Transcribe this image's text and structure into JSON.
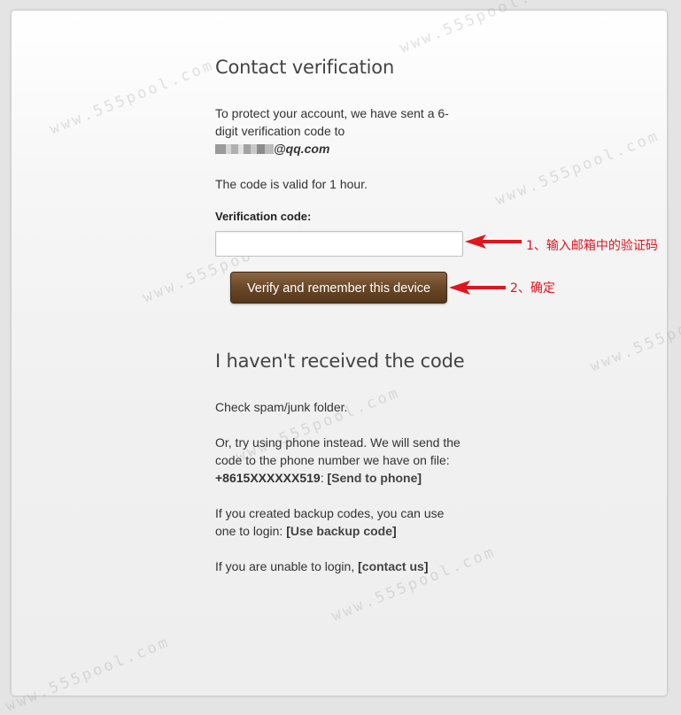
{
  "page": {
    "title": "Contact verification",
    "intro_text": "To protect your account, we have sent a 6-digit verification code to",
    "email_masked_suffix": "@qq.com",
    "validity_text": "The code is valid for 1 hour.",
    "code_label": "Verification code:",
    "code_value": "",
    "verify_button_label": "Verify and remember this device"
  },
  "not_received": {
    "title": "I haven't received the code",
    "spam_text": "Check spam/junk folder.",
    "phone_text": "Or, try using phone instead. We will send the code to the phone number we have on file:",
    "phone_number": "+8615XXXXXX519",
    "phone_sep": ": ",
    "send_to_phone_link": "Send to phone",
    "backup_text": "If you created backup codes, you can use one to login:",
    "use_backup_link": "Use backup code",
    "unable_text": "If you are unable to login,",
    "contact_us_link": "contact us"
  },
  "annotations": {
    "step1": "1、输入邮箱中的验证码",
    "step2": "2、确定",
    "color": "#e0151e"
  },
  "watermark": {
    "text": "www.555pool.com"
  }
}
